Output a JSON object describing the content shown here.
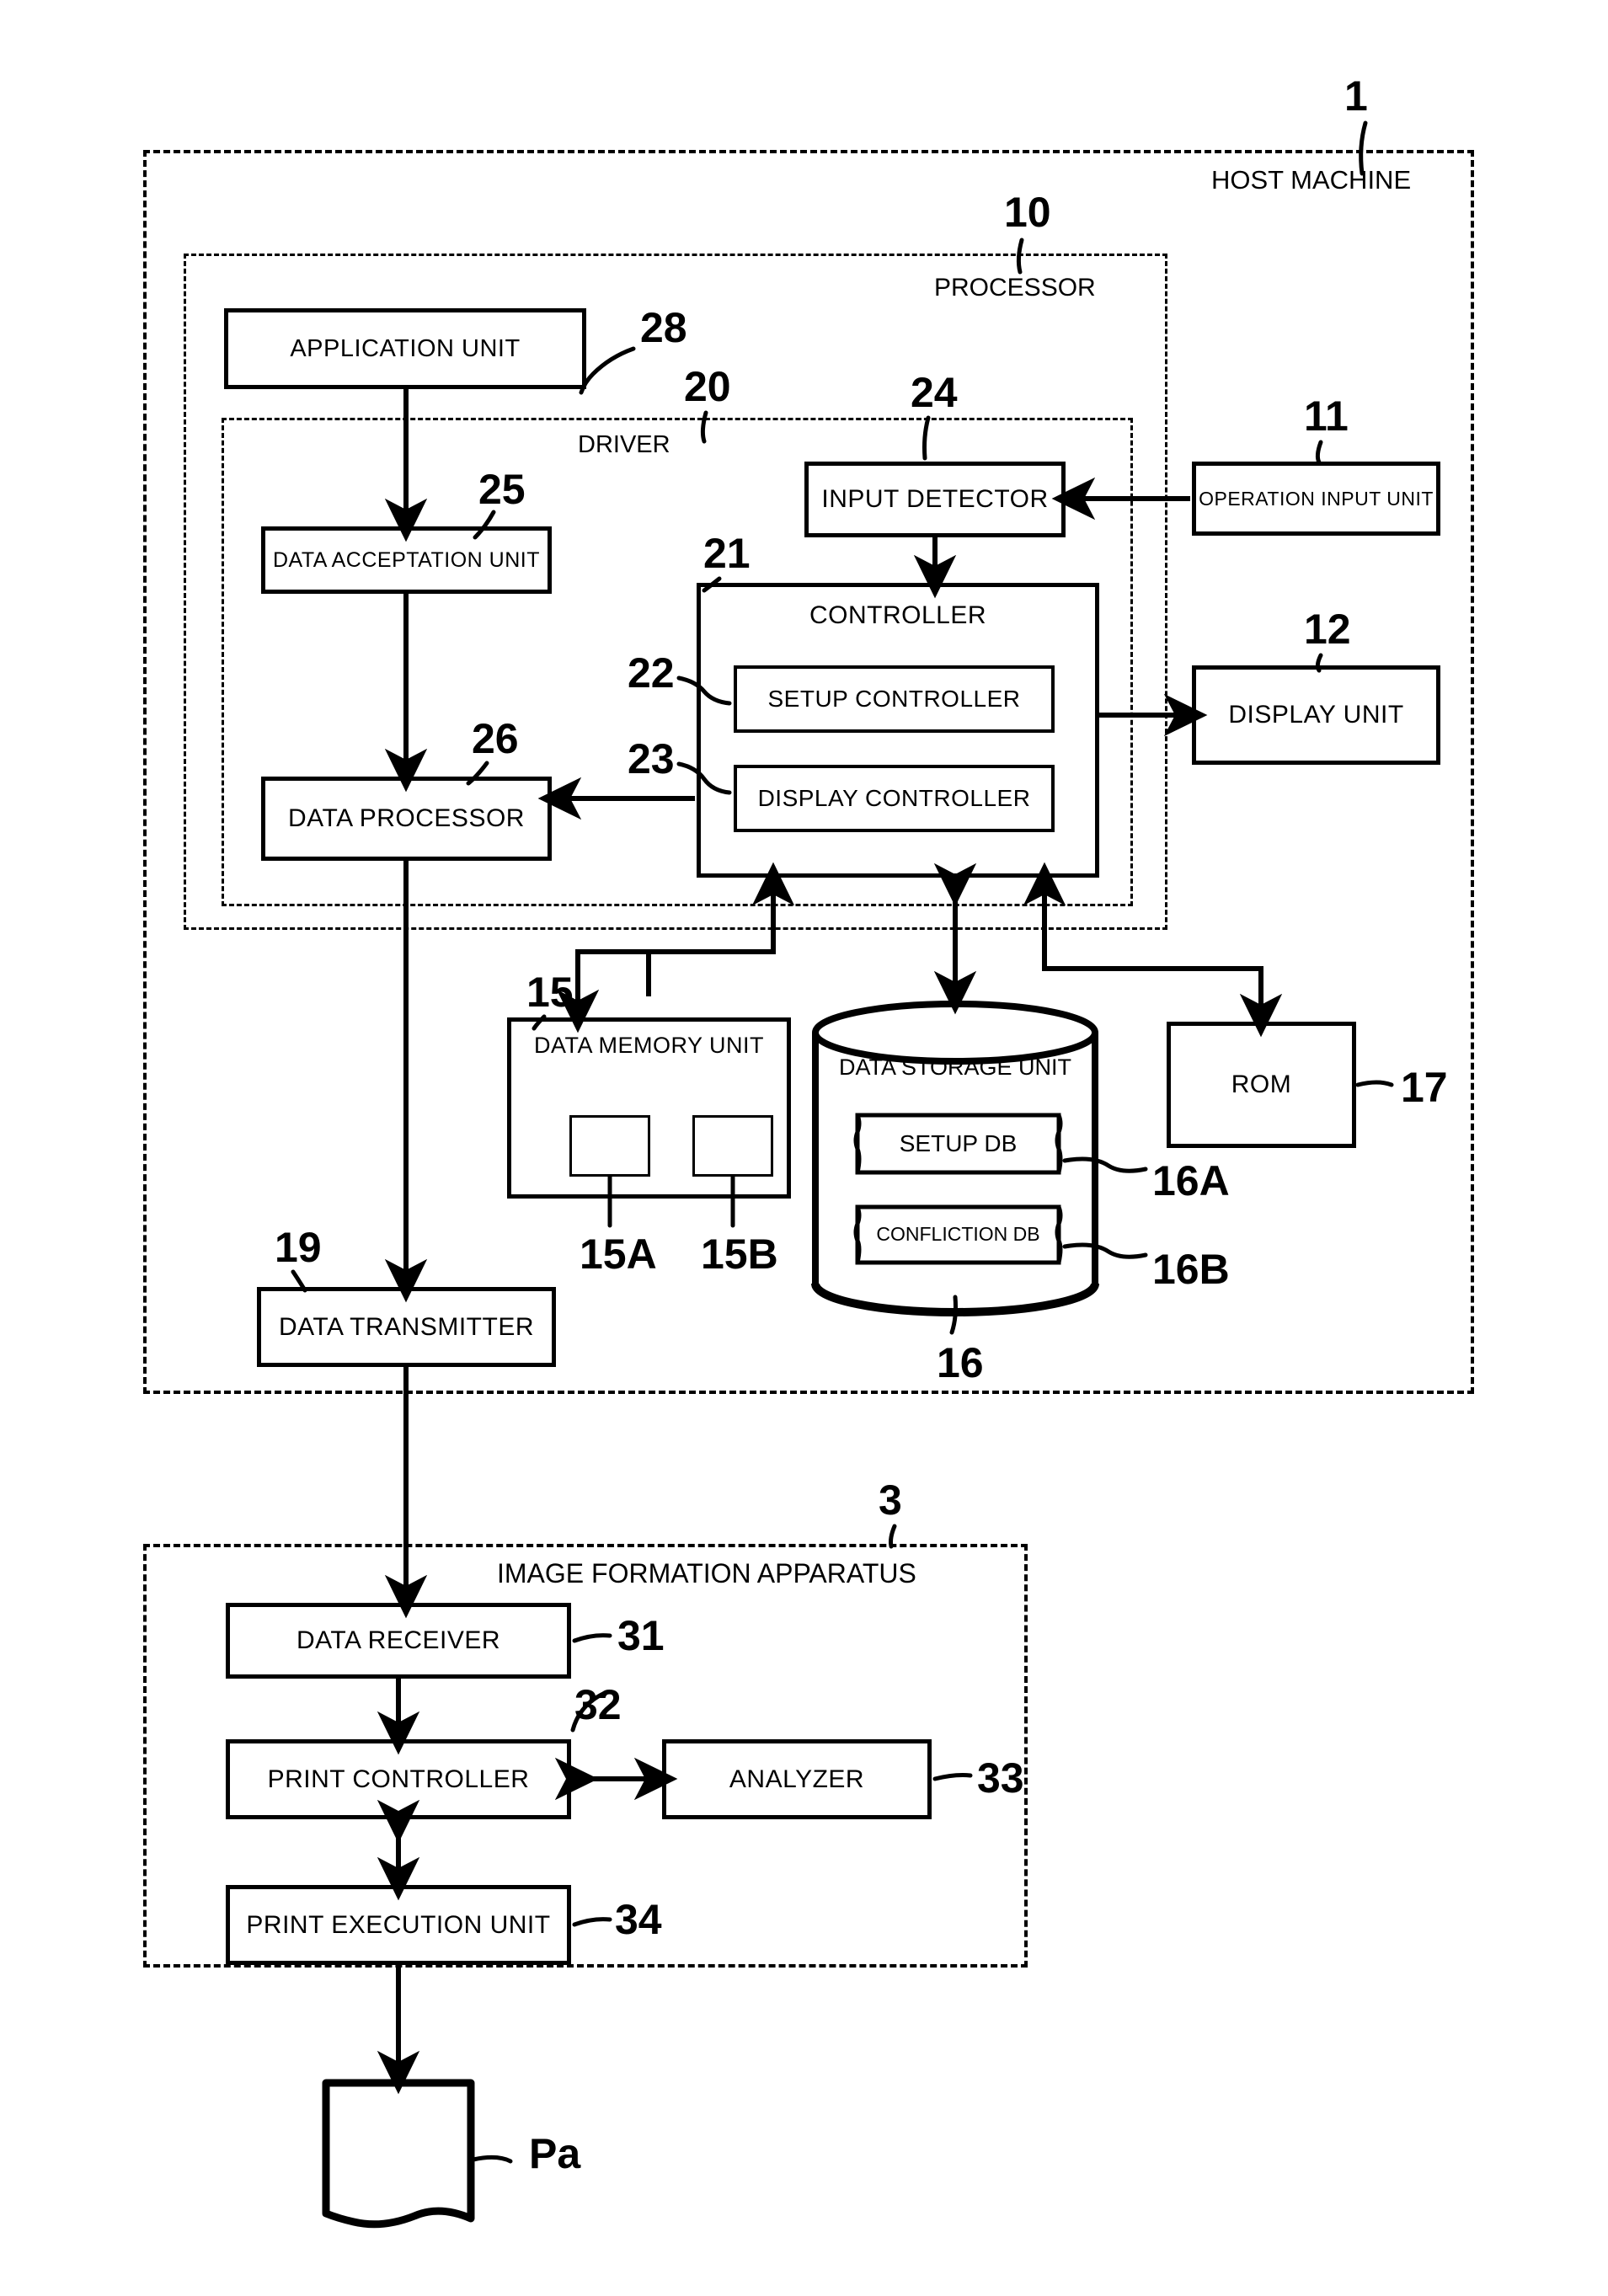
{
  "figure": {
    "containers": [
      {
        "id": "host",
        "label": "HOST MACHINE",
        "ref": "1"
      },
      {
        "id": "processor",
        "label": "PROCESSOR",
        "ref": "10"
      },
      {
        "id": "driver",
        "label": "DRIVER",
        "ref": "20"
      },
      {
        "id": "apparatus",
        "label": "IMAGE FORMATION APPARATUS",
        "ref": "3"
      }
    ],
    "blocks": [
      {
        "id": "application_unit",
        "label": "APPLICATION UNIT",
        "ref": "28"
      },
      {
        "id": "data_acceptation",
        "label": "DATA ACCEPTATION UNIT",
        "ref": "25"
      },
      {
        "id": "data_processor",
        "label": "DATA PROCESSOR",
        "ref": "26"
      },
      {
        "id": "input_detector",
        "label": "INPUT DETECTOR",
        "ref": "24"
      },
      {
        "id": "operation_input",
        "label": "OPERATION INPUT UNIT",
        "ref": "11"
      },
      {
        "id": "controller",
        "label": "CONTROLLER",
        "ref": "21"
      },
      {
        "id": "setup_controller",
        "label": "SETUP CONTROLLER",
        "ref": "22"
      },
      {
        "id": "display_controller",
        "label": "DISPLAY CONTROLLER",
        "ref": "23"
      },
      {
        "id": "display_unit",
        "label": "DISPLAY UNIT",
        "ref": "12"
      },
      {
        "id": "data_memory_unit",
        "label": "DATA MEMORY UNIT",
        "ref": "15"
      },
      {
        "id": "memory_area_a",
        "label": "",
        "ref": "15A"
      },
      {
        "id": "memory_area_b",
        "label": "",
        "ref": "15B"
      },
      {
        "id": "data_storage_unit",
        "label": "DATA STORAGE UNIT",
        "ref": "16"
      },
      {
        "id": "setup_db",
        "label": "SETUP DB",
        "ref": "16A"
      },
      {
        "id": "confliction_db",
        "label": "CONFLICTION DB",
        "ref": "16B"
      },
      {
        "id": "rom",
        "label": "ROM",
        "ref": "17"
      },
      {
        "id": "data_transmitter",
        "label": "DATA TRANSMITTER",
        "ref": "19"
      },
      {
        "id": "data_receiver",
        "label": "DATA RECEIVER",
        "ref": "31"
      },
      {
        "id": "print_controller",
        "label": "PRINT CONTROLLER",
        "ref": "32"
      },
      {
        "id": "analyzer",
        "label": "ANALYZER",
        "ref": "33"
      },
      {
        "id": "print_execution",
        "label": "PRINT EXECUTION UNIT",
        "ref": "34"
      },
      {
        "id": "paper",
        "label": "",
        "ref": "Pa"
      }
    ]
  },
  "labels": {
    "host_machine": "HOST MACHINE",
    "processor": "PROCESSOR",
    "driver": "DRIVER",
    "apparatus": "IMAGE FORMATION APPARATUS",
    "application_unit": "APPLICATION UNIT",
    "data_acceptation_unit": "DATA ACCEPTATION UNIT",
    "data_processor": "DATA PROCESSOR",
    "input_detector": "INPUT DETECTOR",
    "operation_input_unit": "OPERATION INPUT UNIT",
    "controller": "CONTROLLER",
    "setup_controller": "SETUP CONTROLLER",
    "display_controller": "DISPLAY CONTROLLER",
    "display_unit": "DISPLAY UNIT",
    "data_memory_unit": "DATA MEMORY UNIT",
    "data_storage_unit": "DATA STORAGE UNIT",
    "setup_db": "SETUP DB",
    "confliction_db": "CONFLICTION DB",
    "rom": "ROM",
    "data_transmitter": "DATA TRANSMITTER",
    "data_receiver": "DATA RECEIVER",
    "print_controller": "PRINT CONTROLLER",
    "analyzer": "ANALYZER",
    "print_execution_unit": "PRINT EXECUTION UNIT"
  },
  "refs": {
    "host_machine": "1",
    "apparatus": "3",
    "processor": "10",
    "operation_input_unit": "11",
    "display_unit": "12",
    "data_memory_unit": "15",
    "memory_area_a": "15A",
    "memory_area_b": "15B",
    "data_storage_unit": "16",
    "setup_db": "16A",
    "confliction_db": "16B",
    "rom": "17",
    "data_transmitter": "19",
    "driver": "20",
    "controller": "21",
    "setup_controller": "22",
    "display_controller": "23",
    "input_detector": "24",
    "data_acceptation_unit": "25",
    "data_processor": "26",
    "application_unit": "28",
    "data_receiver": "31",
    "print_controller": "32",
    "analyzer": "33",
    "print_execution_unit": "34",
    "paper": "Pa"
  },
  "colors": {
    "ink": "#000000",
    "paper": "#ffffff"
  }
}
